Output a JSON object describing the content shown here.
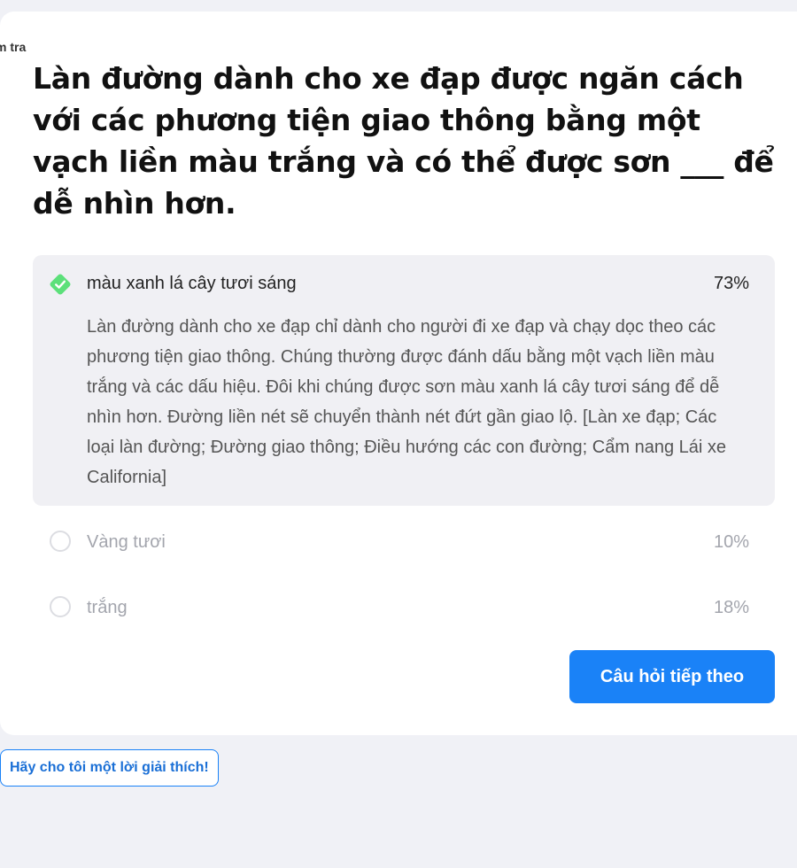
{
  "header": {
    "corner_label": "m tra"
  },
  "question": {
    "text": "Làn đường dành cho xe đạp được ngăn cách với các phương tiện giao thông bằng một vạch liền màu trắng và có thể được sơn ___ để dễ nhìn hơn."
  },
  "answers": [
    {
      "label": "màu xanh lá cây tươi sáng",
      "percent": "73%",
      "selected": true,
      "correct": true,
      "explanation": "Làn đường dành cho xe đạp chỉ dành cho người đi xe đạp và chạy dọc theo các phương tiện giao thông. Chúng thường được đánh dấu bằng một vạch liền màu trắng và các dấu hiệu. Đôi khi chúng được sơn màu xanh lá cây tươi sáng để dễ nhìn hơn. Đường liền nét sẽ chuyển thành nét đứt gần giao lộ. [Làn xe đạp; Các loại làn đường; Đường giao thông; Điều hướng các con đường; Cẩm nang Lái xe California]"
    },
    {
      "label": "Vàng tươi",
      "percent": "10%",
      "selected": false
    },
    {
      "label": "trắng",
      "percent": "18%",
      "selected": false
    }
  ],
  "buttons": {
    "next_label": "Câu hỏi tiếp theo",
    "explain_label": "Hãy cho tôi một lời giải thích!"
  },
  "icons": {
    "selected": "check-diamond-icon",
    "unselected": "radio-circle-icon"
  },
  "colors": {
    "accent": "#1a82f7",
    "correct": "#5ce07a",
    "page_bg": "#f0f1f6",
    "selected_bg": "#f0f0f4"
  }
}
